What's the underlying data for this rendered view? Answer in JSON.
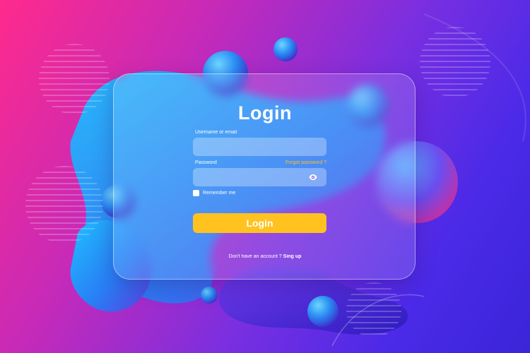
{
  "login": {
    "title": "Login",
    "username_label": "Username or email",
    "username_value": "",
    "password_label": "Password",
    "password_value": "",
    "forgot_label": "Forgot password ?",
    "remember_label": "Remember me",
    "remember_checked": false,
    "button_label": "Login",
    "footer_text": "Don't have an account ? ",
    "signup_label": "Sing up"
  },
  "icons": {
    "password_toggle": "eye-icon"
  },
  "colors": {
    "accent": "#ffc21e",
    "background_start": "#ff2a8c",
    "background_end": "#3a25d8",
    "sphere": "#2aa6ff"
  }
}
